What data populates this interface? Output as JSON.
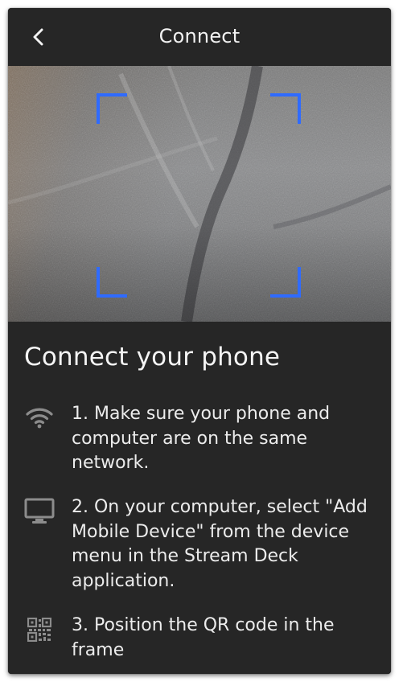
{
  "header": {
    "title": "Connect",
    "back_icon": "chevron-left-icon"
  },
  "camera": {
    "frame_color": "#2f6bff"
  },
  "content": {
    "heading": "Connect your phone",
    "steps": [
      {
        "icon": "wifi-icon",
        "text": "1. Make sure your phone and computer are on the same network."
      },
      {
        "icon": "monitor-icon",
        "text": "2. On your computer, select \"Add Mobile Device\" from the device menu in the Stream Deck application."
      },
      {
        "icon": "qr-code-icon",
        "text": "3. Position the QR code in the frame"
      }
    ]
  },
  "colors": {
    "background": "#262626",
    "text": "#ececec",
    "icon": "#8c8c8c",
    "accent": "#2f6bff"
  }
}
